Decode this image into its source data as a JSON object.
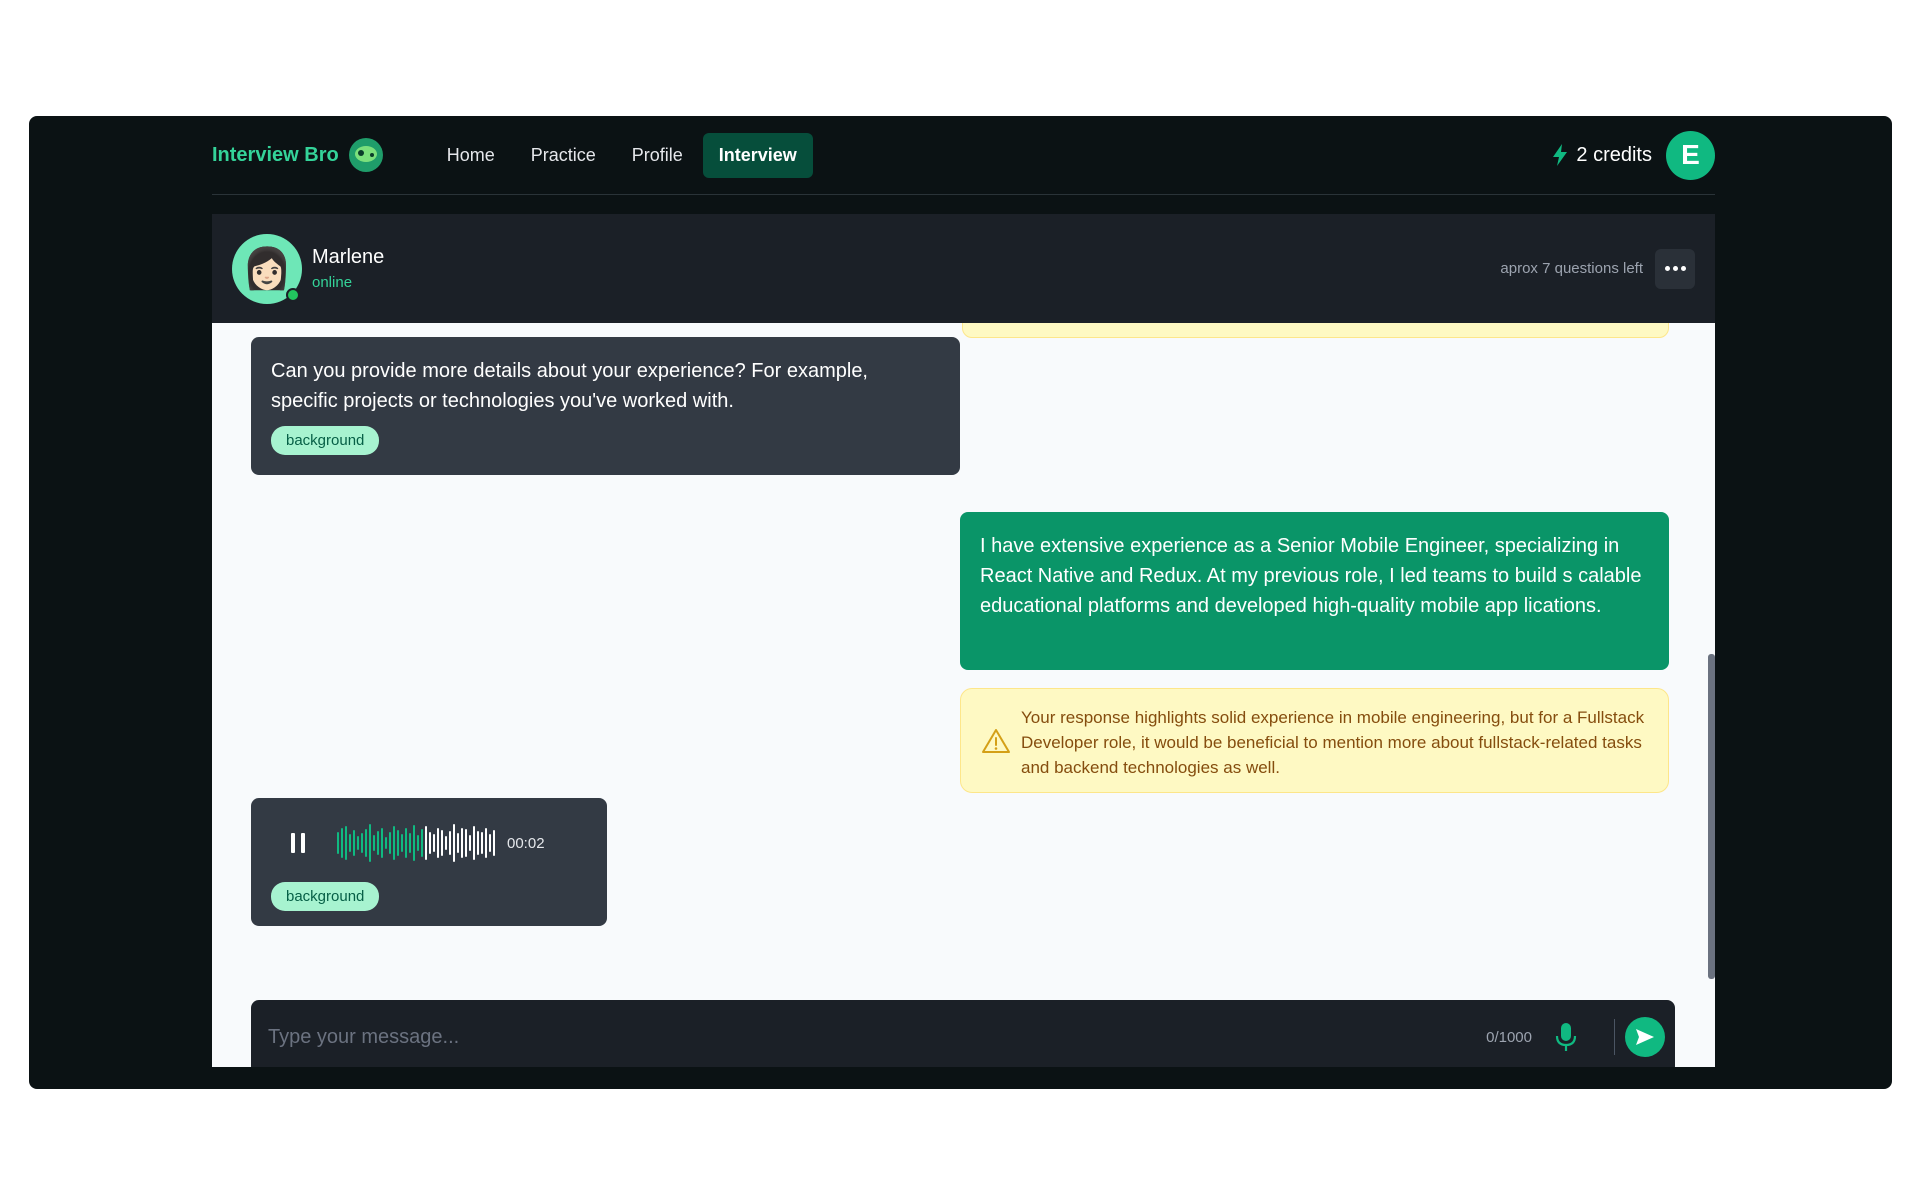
{
  "nav": {
    "brand": "Interview Bro",
    "links": [
      {
        "label": "Home",
        "active": false
      },
      {
        "label": "Practice",
        "active": false
      },
      {
        "label": "Profile",
        "active": false
      },
      {
        "label": "Interview",
        "active": true
      }
    ],
    "credits": "2 credits",
    "user_initial": "E"
  },
  "chat": {
    "agent_name": "Marlene",
    "agent_status": "online",
    "questions_left": "aprox 7 questions left",
    "messages": [
      {
        "role": "interviewer",
        "text": "Can you provide more details about your experience? For example, specific projects or technologies you've worked with.",
        "tag": "background"
      },
      {
        "role": "candidate",
        "text": "I have extensive experience as a Senior Mobile Engineer, specializing in React Native and Redux. At my previous role, I led teams to build s calable educational platforms and developed high-quality mobile app lications."
      },
      {
        "role": "feedback",
        "icon": "warning-icon",
        "text": "Your response highlights solid experience in mobile engineering, but for a Fullstack Developer role, it would be beneficial to mention more about fullstack-related tasks and backend technologies as well."
      },
      {
        "role": "interviewer",
        "type": "voice",
        "duration": "00:02",
        "playback_progress": 0.55,
        "tag": "background"
      }
    ]
  },
  "composer": {
    "placeholder": "Type your message...",
    "counter": "0/1000"
  },
  "colors": {
    "accent": "#10b981",
    "user_bubble": "#0a9568",
    "bot_bubble": "#333a44",
    "feedback_bg": "#fef9c3"
  }
}
